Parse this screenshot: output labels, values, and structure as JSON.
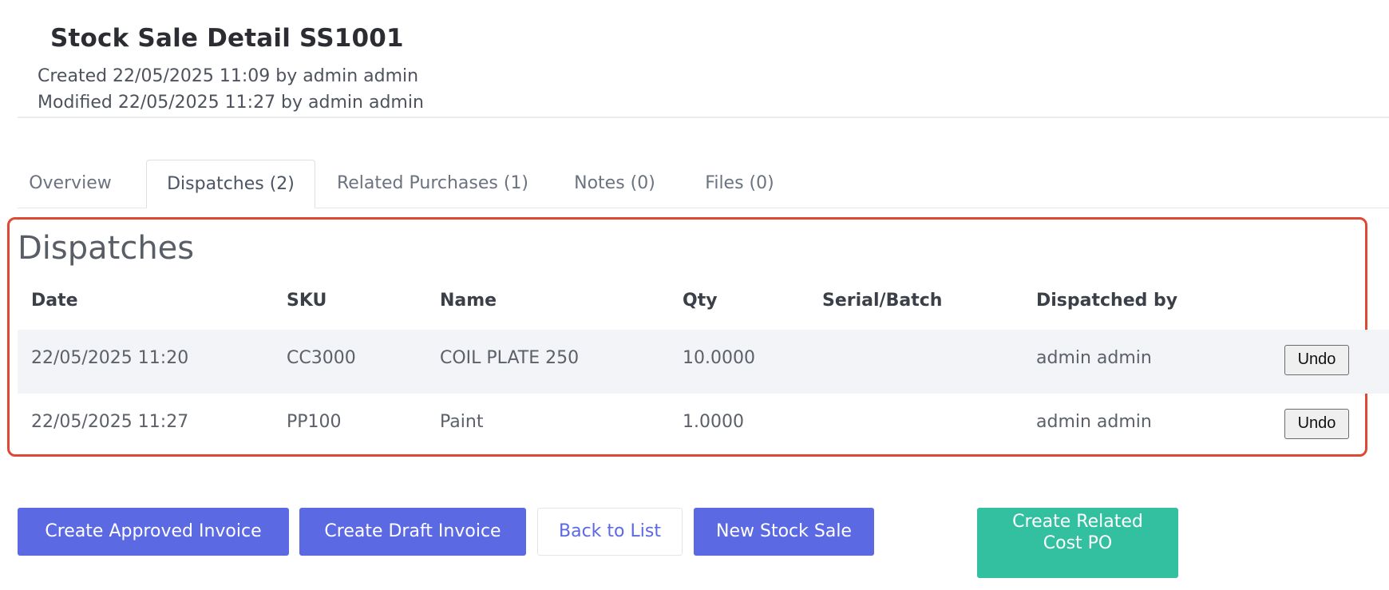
{
  "header": {
    "title": "Stock Sale Detail SS1001",
    "created": "Created 22/05/2025 11:09 by admin admin",
    "modified": "Modified 22/05/2025 11:27 by admin admin"
  },
  "tabs": [
    {
      "label": "Overview",
      "active": false
    },
    {
      "label": "Dispatches (2)",
      "active": true
    },
    {
      "label": "Related Purchases (1)",
      "active": false
    },
    {
      "label": "Notes (0)",
      "active": false
    },
    {
      "label": "Files (0)",
      "active": false
    }
  ],
  "dispatches": {
    "title": "Dispatches",
    "columns": [
      "Date",
      "SKU",
      "Name",
      "Qty",
      "Serial/Batch",
      "Dispatched by"
    ],
    "rows": [
      {
        "date": "22/05/2025 11:20",
        "sku": "CC3000",
        "name": "COIL PLATE 250",
        "qty": "10.0000",
        "serial": "",
        "dispatched_by": "admin admin",
        "action": "Undo"
      },
      {
        "date": "22/05/2025 11:27",
        "sku": "PP100",
        "name": "Paint",
        "qty": "1.0000",
        "serial": "",
        "dispatched_by": "admin admin",
        "action": "Undo"
      }
    ]
  },
  "actions": {
    "create_approved_invoice": "Create Approved Invoice",
    "create_draft_invoice": "Create Draft Invoice",
    "back_to_list": "Back to List",
    "new_stock_sale": "New Stock Sale",
    "create_related_cost_po_line1": "Create Related",
    "create_related_cost_po_line2": "Cost PO"
  },
  "colors": {
    "primary": "#5b69e2",
    "success": "#33c0a1",
    "highlight_border": "#e04836",
    "row_stripe": "#f3f4f7"
  }
}
